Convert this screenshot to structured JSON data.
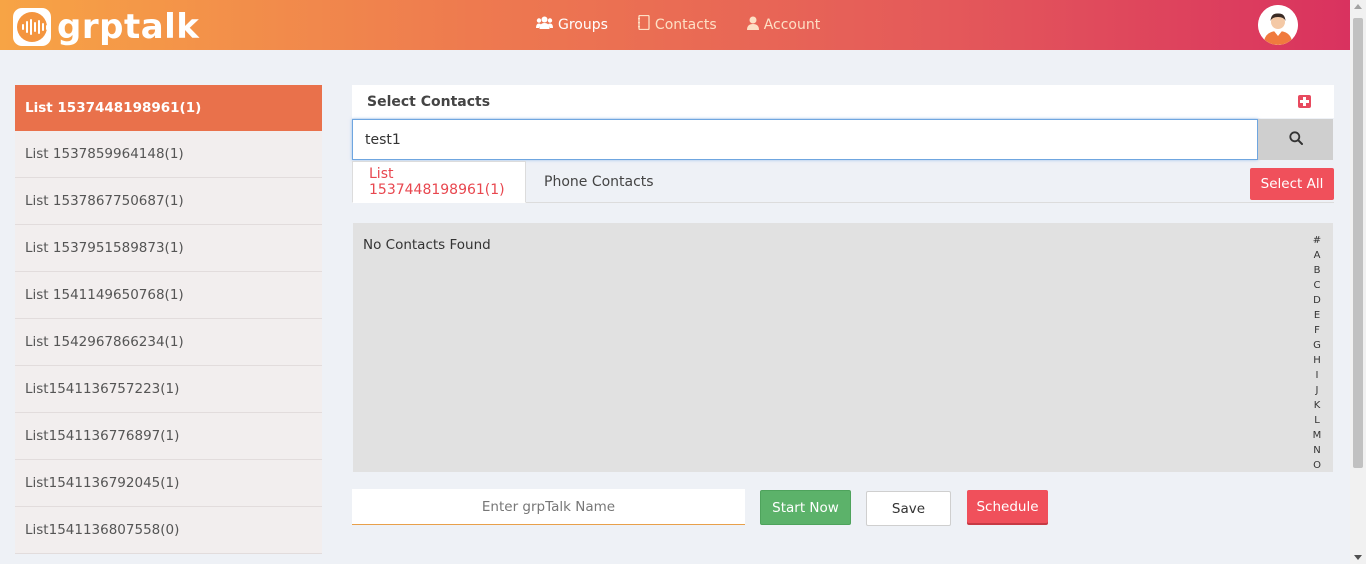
{
  "brand": {
    "name": "grptalk"
  },
  "nav": {
    "items": [
      {
        "label": "Groups",
        "icon": "users-icon"
      },
      {
        "label": "Contacts",
        "icon": "address-book-icon"
      },
      {
        "label": "Account",
        "icon": "user-icon"
      }
    ]
  },
  "sidebar": {
    "items": [
      {
        "label": "List 1537448198961(1)",
        "active": true
      },
      {
        "label": "List 1537859964148(1)"
      },
      {
        "label": "List 1537867750687(1)"
      },
      {
        "label": "List 1537951589873(1)"
      },
      {
        "label": "List 1541149650768(1)"
      },
      {
        "label": "List 1542967866234(1)"
      },
      {
        "label": "List1541136757223(1)"
      },
      {
        "label": "List1541136776897(1)"
      },
      {
        "label": "List1541136792045(1)"
      },
      {
        "label": "List1541136807558(0)"
      }
    ]
  },
  "main": {
    "title": "Select Contacts",
    "search": {
      "value": "test1"
    },
    "tabs": [
      {
        "label": "List 1537448198961(1)"
      },
      {
        "label": "Phone Contacts"
      }
    ],
    "select_all": "Select All",
    "empty_message": "No Contacts Found",
    "alphabet": [
      "#",
      "A",
      "B",
      "C",
      "D",
      "E",
      "F",
      "G",
      "H",
      "I",
      "J",
      "K",
      "L",
      "M",
      "N",
      "O"
    ],
    "name_input": {
      "placeholder": "Enter grpTalk Name"
    },
    "buttons": {
      "start": "Start Now",
      "save": "Save",
      "schedule": "Schedule"
    }
  },
  "colors": {
    "accent": "#e9714b",
    "danger": "#f0505b",
    "success": "#5cb26a"
  }
}
